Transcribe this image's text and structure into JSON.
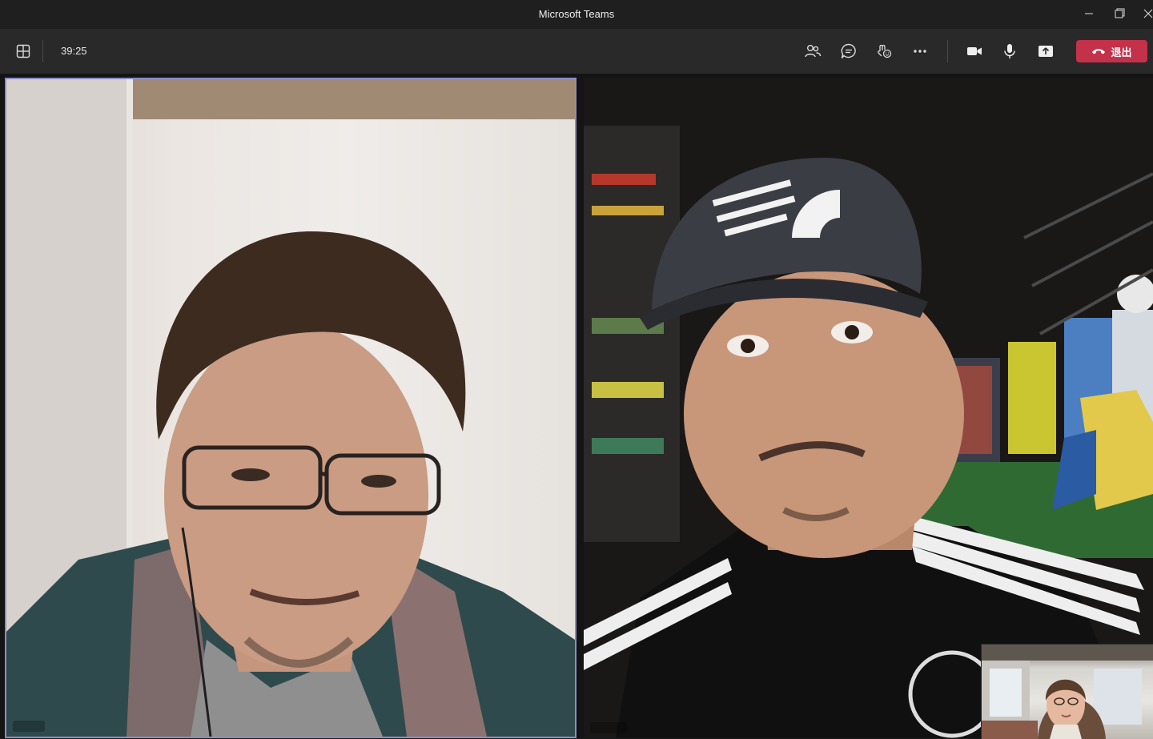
{
  "window": {
    "title": "Microsoft Teams"
  },
  "toolbar": {
    "timer": "39:25",
    "leave_label": "退出",
    "icons": {
      "layout": "grid-layout-icon",
      "participants": "people-icon",
      "chat": "chat-icon",
      "reactions": "reactions-icon",
      "more": "more-icon",
      "camera": "camera-icon",
      "mic": "microphone-icon",
      "share": "share-screen-icon",
      "leave": "phone-hangup-icon"
    }
  },
  "colors": {
    "titlebar": "#1f1f1f",
    "toolbar": "#292929",
    "leave_button": "#c4314b",
    "active_speaker_border": "#8b8cc7"
  }
}
